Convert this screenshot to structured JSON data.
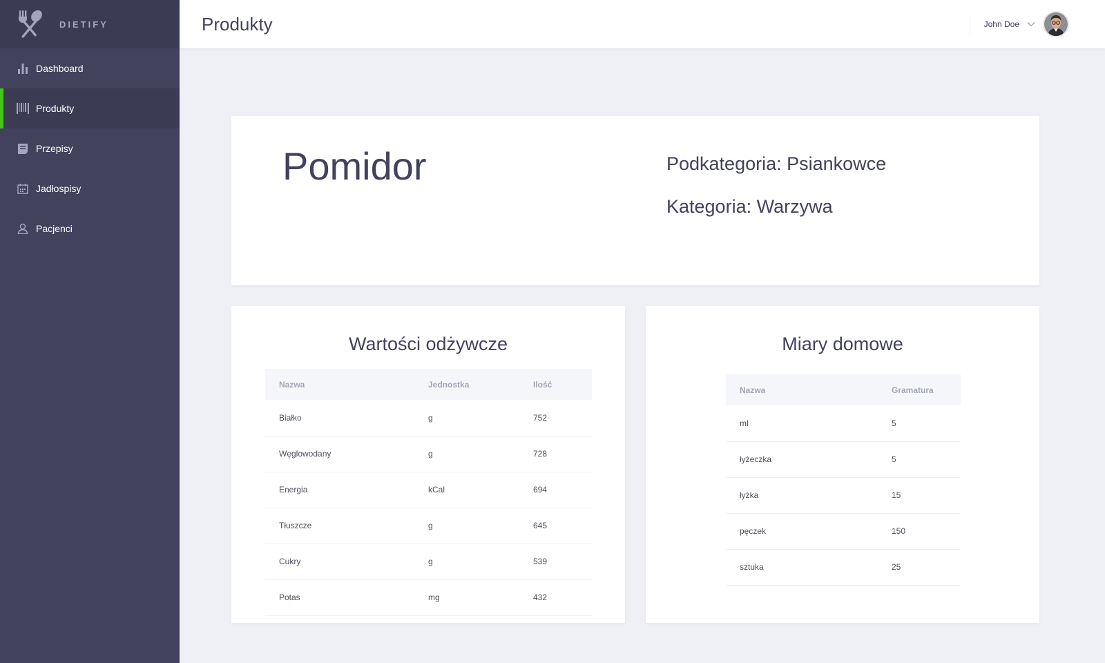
{
  "app": {
    "brand": "DIETIFY",
    "brand_color": "#43425d",
    "accent": "#43c51a"
  },
  "sidebar": {
    "items": [
      {
        "label": "Dashboard",
        "icon": "bar-chart-icon",
        "active": false
      },
      {
        "label": "Produkty",
        "icon": "barcode-icon",
        "active": true
      },
      {
        "label": "Przepisy",
        "icon": "recipe-icon",
        "active": false
      },
      {
        "label": "Jadłospisy",
        "icon": "calendar-icon",
        "active": false
      },
      {
        "label": "Pacjenci",
        "icon": "user-icon",
        "active": false
      }
    ]
  },
  "header": {
    "title": "Produkty",
    "user_name": "John Doe"
  },
  "product": {
    "name": "Pomidor",
    "subcategory_line": "Podkategoria: Psiankowce",
    "category_line": "Kategoria: Warzywa"
  },
  "nutrition": {
    "title": "Wartości odżywcze",
    "columns": [
      "Nazwa",
      "Jednostka",
      "Ilość"
    ],
    "rows": [
      [
        "Białko",
        "g",
        "752"
      ],
      [
        "Węglowodany",
        "g",
        "728"
      ],
      [
        "Energia",
        "kCal",
        "694"
      ],
      [
        "Tłuszcze",
        "g",
        "645"
      ],
      [
        "Cukry",
        "g",
        "539"
      ],
      [
        "Potas",
        "mg",
        "432"
      ]
    ]
  },
  "measures": {
    "title": "Miary domowe",
    "columns": [
      "Nazwa",
      "Gramatura"
    ],
    "rows": [
      [
        "ml",
        "5"
      ],
      [
        "łyżeczka",
        "5"
      ],
      [
        "łyżka",
        "15"
      ],
      [
        "pęczek",
        "150"
      ],
      [
        "sztuka",
        "25"
      ]
    ]
  }
}
